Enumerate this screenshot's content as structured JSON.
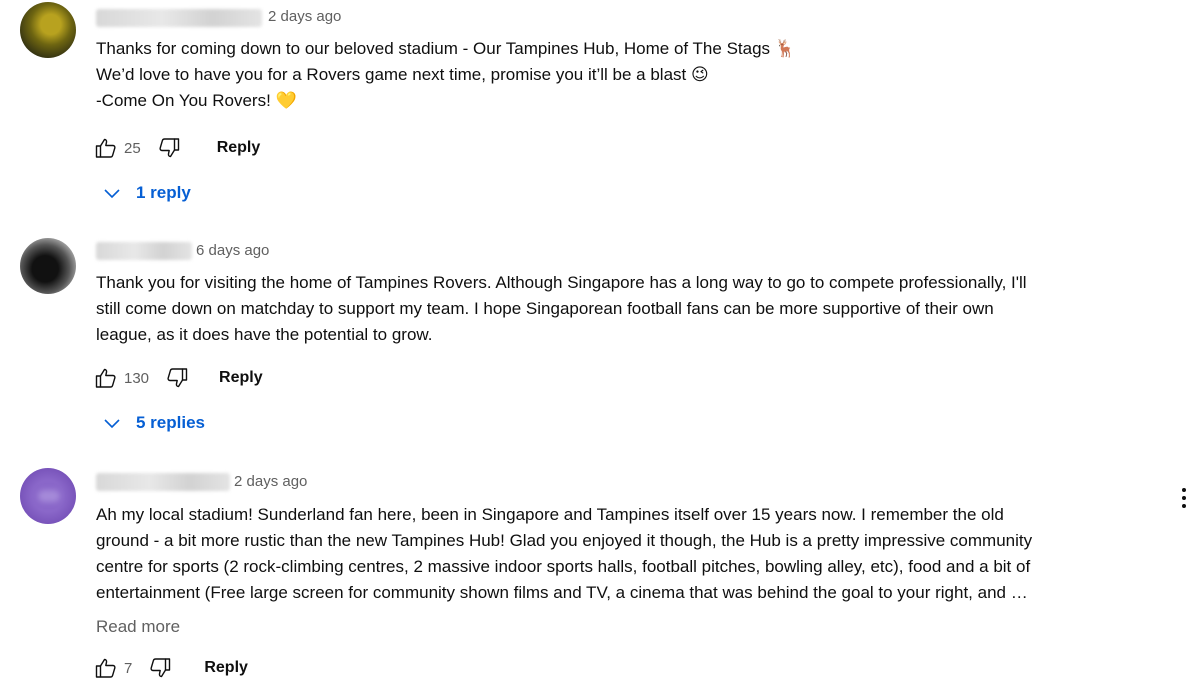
{
  "comments": [
    {
      "time": "2 days ago",
      "lines": [
        "Thanks for coming down to our beloved stadium - Our Tampines Hub, Home of The Stags 🦌",
        "We’d love to have you for a Rovers game next time, promise you it’ll be a blast 😉",
        "-Come On You Rovers! 💛"
      ],
      "likes": "25",
      "reply_label": "Reply",
      "replies_label": "1 reply"
    },
    {
      "time": "6 days ago",
      "lines": [
        "Thank you for visiting the home of Tampines Rovers. Although Singapore has a long way to go to compete professionally, I'll",
        "still come down on matchday to support my team. I hope Singaporean football fans can be more supportive of their own",
        "league, as it does have the potential to grow."
      ],
      "likes": "130",
      "reply_label": "Reply",
      "replies_label": "5 replies"
    },
    {
      "time": "2 days ago",
      "lines": [
        "Ah my local stadium! Sunderland fan here, been in Singapore and Tampines itself over 15 years now. I remember the old",
        "ground - a bit more rustic than the new Tampines Hub! Glad you enjoyed it though, the Hub is a pretty impressive community",
        "centre for sports (2 rock-climbing centres, 2 massive indoor sports halls, football pitches, bowling alley, etc), food and a bit of",
        "entertainment (Free large screen for community shown films and TV, a cinema that was behind the goal to your right, and …"
      ],
      "read_more": "Read more",
      "likes": "7",
      "reply_label": "Reply"
    }
  ],
  "colors": {
    "link_blue": "#065fd4",
    "secondary_text": "#606060",
    "primary_text": "#0f0f0f"
  },
  "icons": [
    "thumb-up-icon",
    "thumb-down-icon",
    "chevron-down-icon",
    "more-vert-icon"
  ]
}
